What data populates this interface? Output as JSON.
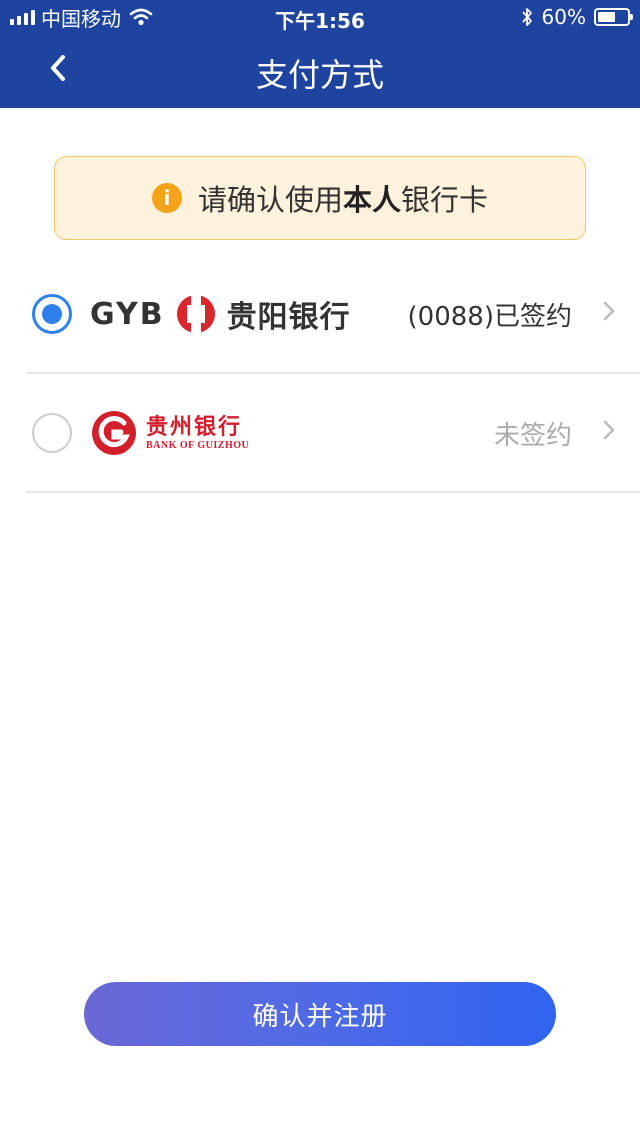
{
  "status_bar": {
    "carrier": "中国移动",
    "time": "下午1:56",
    "battery": "60%",
    "battery_level": 0.6
  },
  "nav": {
    "title": "支付方式",
    "back_icon": "chevron-left-icon"
  },
  "notice": {
    "icon": "info-icon",
    "icon_glyph": "i",
    "prefix": "请确认使用",
    "bold": "本人",
    "suffix": "银行卡"
  },
  "banks": [
    {
      "logo_text": "GYB",
      "logo_cn": "贵阳银行",
      "status": "(0088)已签约",
      "selected": true
    },
    {
      "logo_cn": "贵州银行",
      "logo_en": "BANK OF GUIZHOU",
      "status": "未签约",
      "selected": false
    }
  ],
  "confirm_button": "确认并注册",
  "colors": {
    "header": "#1e44a0",
    "accent": "#2f80ed",
    "notice_bg": "#fdf2dc",
    "notice_border": "#f7c76a",
    "gyb_red": "#d9262c",
    "gz_red": "#d21f2b",
    "button_gradient_start": "#6b68d6",
    "button_gradient_end": "#2f63f0"
  }
}
